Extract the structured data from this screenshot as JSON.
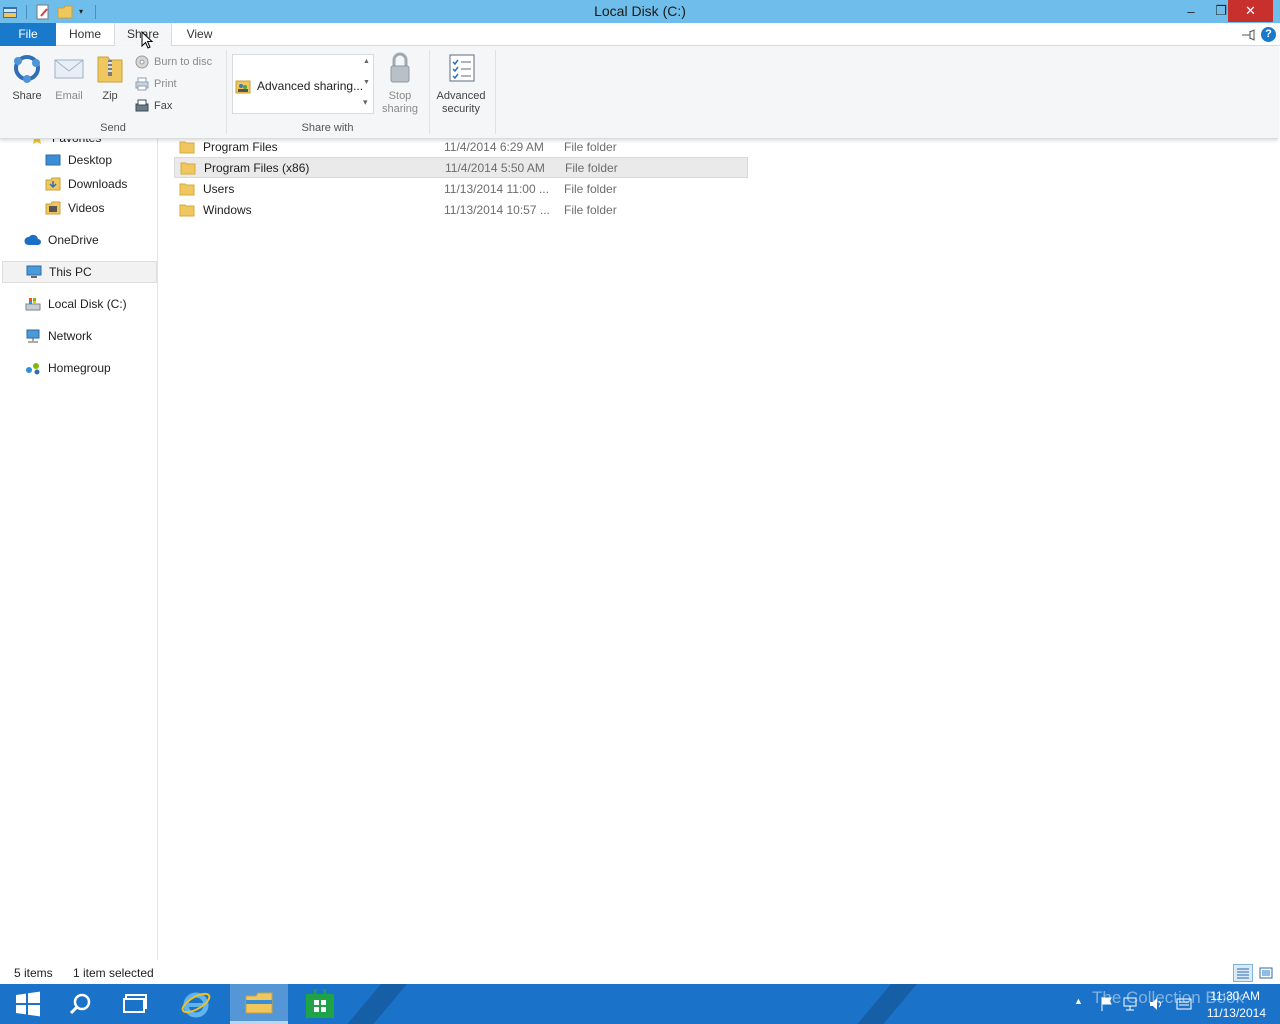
{
  "window": {
    "title": "Local Disk (C:)",
    "minimize_glyph": "–",
    "maximize_glyph": "❐",
    "close_glyph": "✕"
  },
  "tabs": {
    "file": "File",
    "home": "Home",
    "share": "Share",
    "view": "View"
  },
  "ribbon": {
    "send": {
      "label": "Send",
      "share": "Share",
      "email": "Email",
      "zip": "Zip",
      "burn": "Burn to disc",
      "print": "Print",
      "fax": "Fax"
    },
    "share_with": {
      "label": "Share with",
      "item": "Advanced sharing...",
      "stop_line1": "Stop",
      "stop_line2": "sharing"
    },
    "advanced_security_line1": "Advanced",
    "advanced_security_line2": "security"
  },
  "nav": {
    "favorites": "Favorites",
    "desktop": "Desktop",
    "downloads": "Downloads",
    "videos": "Videos",
    "onedrive": "OneDrive",
    "thispc": "This PC",
    "localdisk": "Local Disk (C:)",
    "network": "Network",
    "homegroup": "Homegroup"
  },
  "files": [
    {
      "name": "Program Files",
      "date": "11/4/2014 6:29 AM",
      "type": "File folder"
    },
    {
      "name": "Program Files (x86)",
      "date": "11/4/2014 5:50 AM",
      "type": "File folder"
    },
    {
      "name": "Users",
      "date": "11/13/2014 11:00 ...",
      "type": "File folder"
    },
    {
      "name": "Windows",
      "date": "11/13/2014 10:57 ...",
      "type": "File folder"
    }
  ],
  "status": {
    "items": "5 items",
    "selected": "1 item selected"
  },
  "taskbar": {
    "time": "11:30 AM",
    "date": "11/13/2014",
    "watermark": "The Collection Book"
  },
  "colors": {
    "titlebar": "#6fbdea",
    "file_tab": "#1979ca",
    "taskbar": "#1b73c9",
    "close": "#c7302c"
  }
}
